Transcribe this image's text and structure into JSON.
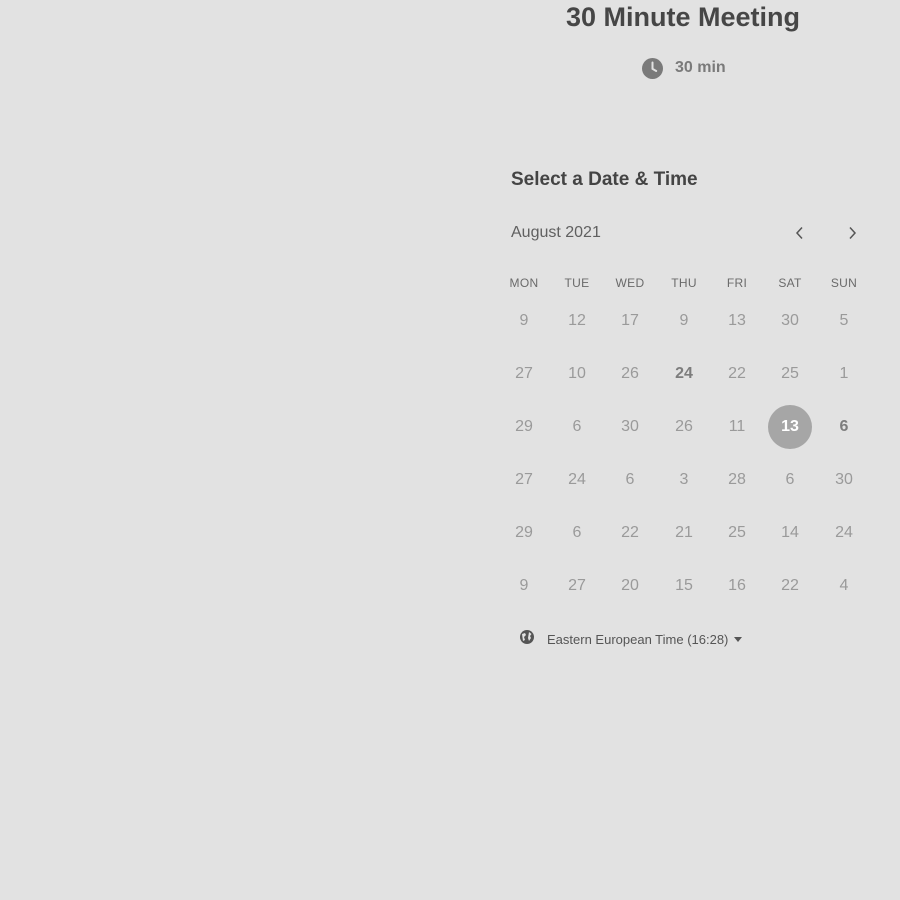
{
  "event": {
    "title": "30 Minute Meeting",
    "duration": "30 min",
    "duration_icon": "clock-icon"
  },
  "calendar": {
    "heading": "Select a Date & Time",
    "month": "August 2021",
    "nav": {
      "prev_icon": "chevron-left-icon",
      "next_icon": "chevron-right-icon"
    },
    "weekdays": [
      "MON",
      "TUE",
      "WED",
      "THU",
      "FRI",
      "SAT",
      "SUN"
    ],
    "weeks": [
      [
        "9",
        "12",
        "17",
        "9",
        "13",
        "30",
        "5"
      ],
      [
        "27",
        "10",
        "26",
        "24",
        "22",
        "25",
        "1"
      ],
      [
        "29",
        "6",
        "30",
        "26",
        "11",
        "13",
        "6"
      ],
      [
        "27",
        "24",
        "6",
        "3",
        "28",
        "6",
        "30"
      ],
      [
        "29",
        "6",
        "22",
        "21",
        "25",
        "14",
        "24"
      ],
      [
        "9",
        "27",
        "20",
        "15",
        "16",
        "22",
        "4"
      ]
    ],
    "available_days": [
      [
        1,
        3
      ],
      [
        2,
        6
      ]
    ],
    "selected_day": [
      2,
      5
    ]
  },
  "timezone": {
    "label": "Eastern European Time (16:28)",
    "icon": "globe-icon",
    "caret_icon": "caret-down-icon"
  },
  "colors": {
    "background": "#e2e2e2",
    "selected_day_bg": "#a6a6a6",
    "selected_day_text": "#ffffff"
  }
}
